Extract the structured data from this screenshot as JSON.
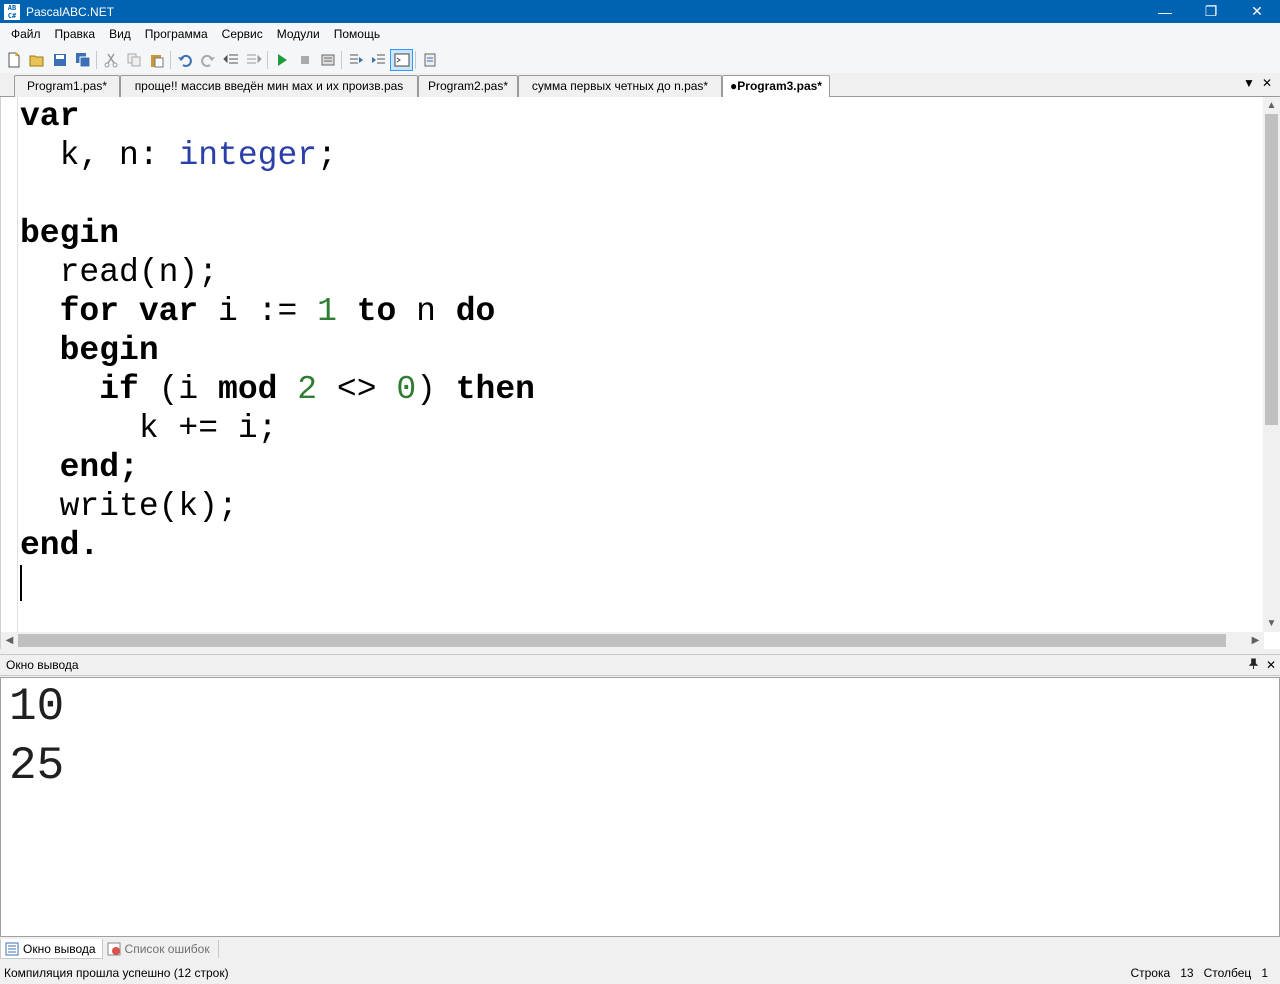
{
  "window": {
    "title": "PascalABC.NET",
    "icon_text": "AB\nC#",
    "controls": {
      "minimize": "—",
      "restore": "❐",
      "close": "✕"
    }
  },
  "menu": [
    "Файл",
    "Правка",
    "Вид",
    "Программа",
    "Сервис",
    "Модули",
    "Помощь"
  ],
  "toolbar_icons": [
    "new-file-icon",
    "open-icon",
    "save-icon",
    "save-all-icon",
    "cut-icon",
    "copy-icon",
    "paste-icon",
    "undo-icon",
    "redo-icon",
    "indent-left-icon",
    "indent-right-icon",
    "run-icon",
    "stop-icon",
    "compile-icon",
    "step-into-icon",
    "step-over-icon",
    "output-window-icon",
    "debug-window-icon"
  ],
  "tabs": [
    {
      "label": "Program1.pas*",
      "active": false
    },
    {
      "label": "проще!! массив введён мин мах и их произв.pas",
      "active": false
    },
    {
      "label": "Program2.pas*",
      "active": false
    },
    {
      "label": "сумма первых четных до n.pas*",
      "active": false
    },
    {
      "label": "●Program3.pas*",
      "active": true
    }
  ],
  "tab_controls": {
    "dropdown": "▼",
    "close": "✕"
  },
  "code_lines": [
    [
      [
        "kw",
        "var"
      ]
    ],
    [
      [
        "id",
        "  k, n: "
      ],
      [
        "ty",
        "integer"
      ],
      [
        "id",
        ";"
      ]
    ],
    [],
    [
      [
        "kw",
        "begin"
      ]
    ],
    [
      [
        "id",
        "  read(n);"
      ]
    ],
    [
      [
        "id",
        "  "
      ],
      [
        "kw",
        "for var"
      ],
      [
        "id",
        " i := "
      ],
      [
        "num",
        "1"
      ],
      [
        "id",
        " "
      ],
      [
        "kw",
        "to"
      ],
      [
        "id",
        " n "
      ],
      [
        "kw",
        "do"
      ]
    ],
    [
      [
        "id",
        "  "
      ],
      [
        "kw",
        "begin"
      ]
    ],
    [
      [
        "id",
        "    "
      ],
      [
        "kw",
        "if"
      ],
      [
        "id",
        " (i "
      ],
      [
        "kw",
        "mod"
      ],
      [
        "id",
        " "
      ],
      [
        "num",
        "2"
      ],
      [
        "id",
        " <> "
      ],
      [
        "num",
        "0"
      ],
      [
        "id",
        ") "
      ],
      [
        "kw",
        "then"
      ]
    ],
    [
      [
        "id",
        "      k += i;"
      ]
    ],
    [
      [
        "id",
        "  "
      ],
      [
        "kw",
        "end;"
      ]
    ],
    [
      [
        "id",
        "  write(k);"
      ]
    ],
    [
      [
        "kw",
        "end."
      ]
    ]
  ],
  "output_panel": {
    "title": "Окно вывода",
    "pin": "📌",
    "close": "✕",
    "lines": [
      "10",
      "25"
    ]
  },
  "bottom_tabs": [
    {
      "label": "Окно вывода",
      "active": true
    },
    {
      "label": "Список ошибок",
      "active": false
    }
  ],
  "status": {
    "message": "Компиляция прошла успешно (12 строк)",
    "row_label": "Строка",
    "row_value": "13",
    "col_label": "Столбец",
    "col_value": "1"
  }
}
